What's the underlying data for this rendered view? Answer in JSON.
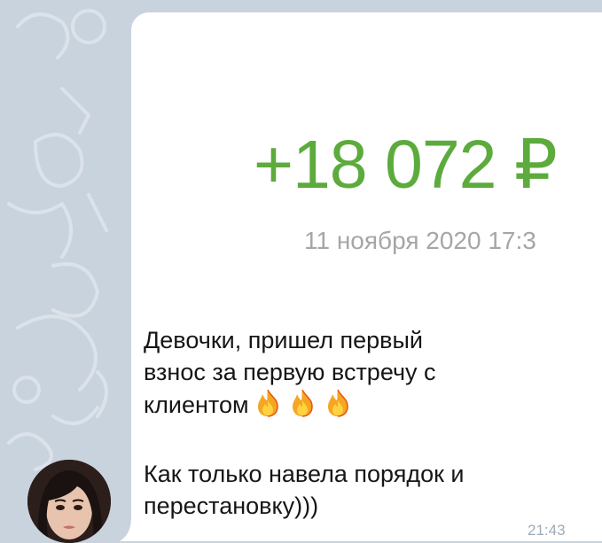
{
  "transfer": {
    "amount": "+18 072 ₽",
    "date": "11 ноября 2020 17:3"
  },
  "message": {
    "lines1": [
      "Девочки, пришел первый",
      "взнос  за первую встречу с"
    ],
    "line3": "клиентом",
    "emoji": [
      "fire",
      "fire",
      "fire"
    ],
    "lines2": [
      "Как только навела порядок и",
      "перестановку)))"
    ],
    "time": "21:43"
  },
  "colors": {
    "amount": "#5cab3c",
    "date": "#a6a6a6",
    "time": "#a0abb6",
    "chat_bg": "#c9d3de",
    "bubble": "#ffffff"
  }
}
